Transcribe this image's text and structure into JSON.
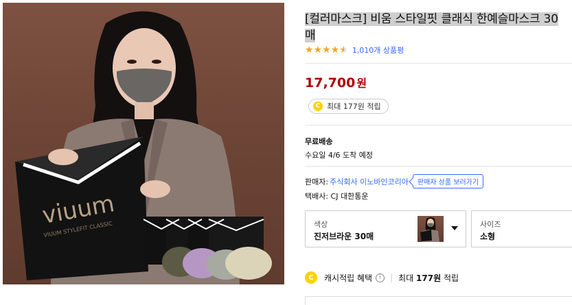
{
  "product": {
    "title": "[컬러마스크] 비움 스타일핏 클래식 한예슬마스크 30매",
    "image_alt": "mask model with product package",
    "package_brand": "viuum",
    "package_tagline": "VIUUM STYLEFIT CLASSIC",
    "rating_value": 4.5,
    "rating_stars": [
      "full",
      "full",
      "full",
      "full",
      "half"
    ],
    "review_count": "1,010개 상품평",
    "price": "17,700",
    "price_unit": "원",
    "reward_chip": "최대 177원 적립"
  },
  "shipping": {
    "label": "무료배송",
    "date": "수요일 4/6 도착 예정"
  },
  "seller": {
    "prefix": "판매자:",
    "name": "주식회사 이노바인코리아",
    "button": "판매자 상품 보러가기",
    "courier": "택배사: CJ 대한통운"
  },
  "options": {
    "color_label": "색상",
    "color_value": "진저브라운 30매",
    "size_label": "사이즈",
    "size_value": "소형"
  },
  "cash": {
    "coin_letter": "C",
    "label": "캐시적립 혜택",
    "info_icon": "i",
    "prefix": "최대",
    "amount": "177원",
    "suffix": "적립"
  },
  "colors": {
    "price": "#ae0000",
    "link": "#346aff",
    "star": "#f5a623",
    "coin": "#ffd200"
  }
}
